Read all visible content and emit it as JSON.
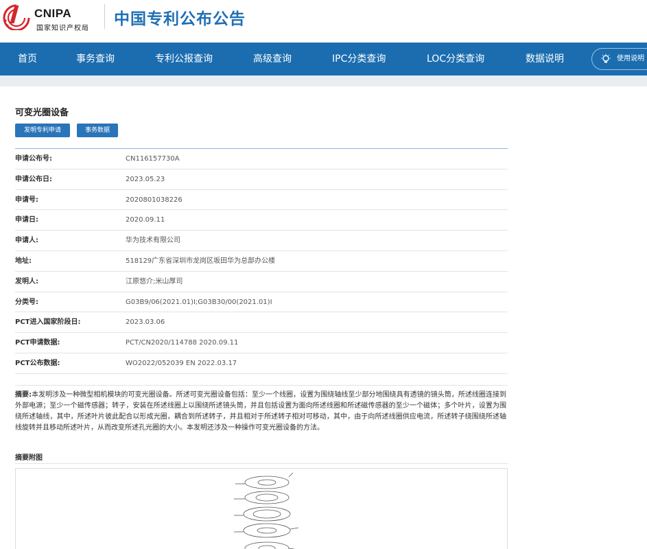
{
  "header": {
    "logo_en": "CNIPA",
    "logo_cn": "国家知识产权局",
    "site_title": "中国专利公布公告"
  },
  "nav": {
    "items": [
      "首页",
      "事务查询",
      "专利公报查询",
      "高级查询",
      "IPC分类查询",
      "LOC分类查询",
      "数据说明"
    ],
    "help_label": "使用说明"
  },
  "patent": {
    "title": "可变光圈设备",
    "tags": [
      "发明专利申请",
      "事务数据"
    ],
    "fields": [
      {
        "label": "申请公布号:",
        "value": "CN116157730A"
      },
      {
        "label": "申请公布日:",
        "value": "2023.05.23"
      },
      {
        "label": "申请号:",
        "value": "2020801038226"
      },
      {
        "label": "申请日:",
        "value": "2020.09.11"
      },
      {
        "label": "申请人:",
        "value": "华为技术有限公司"
      },
      {
        "label": "地址:",
        "value": "518129广东省深圳市龙岗区坂田华为总部办公楼"
      },
      {
        "label": "发明人:",
        "value": "江原悠介;米山厚司"
      },
      {
        "label": "分类号:",
        "value": "G03B9/06(2021.01)I;G03B30/00(2021.01)I"
      },
      {
        "label": "PCT进入国家阶段日:",
        "value": "2023.03.06"
      },
      {
        "label": "PCT申请数据:",
        "value": "PCT/CN2020/114788 2020.09.11"
      },
      {
        "label": "PCT公布数据:",
        "value": "WO2022/052039 EN 2022.03.17"
      }
    ],
    "abstract_label": "摘要:",
    "abstract_text": "本发明涉及一种微型相机模块的可变光圈设备。所述可变光圈设备包括：至少一个线圈，设置为围绕轴线至少部分地围绕具有透镜的镜头筒，所述线圈连接到外部电源；至少一个磁传感器；转子，安装在所述线圈上以围绕所述镜头筒，并且包括设置为面向所述线圈和所述磁传感器的至少一个磁体；多个叶片，设置为围绕所述轴线，其中，所述叶片彼此配合以形成光圈，耦合到所述转子，并且相对于所述转子相对可移动，其中，由于向所述线圈供应电流，所述转子绕围绕所述轴线旋转并且移动所述叶片，从而改变所述孔光圈的大小。本发明还涉及一种操作可变光圈设备的方法。",
    "abstract_image_title": "摘要附图"
  },
  "colors": {
    "brand_blue": "#1b6db0",
    "title_blue": "#1f6fb6",
    "tag_blue": "#2a74b9",
    "logo_red": "#d4262c"
  }
}
